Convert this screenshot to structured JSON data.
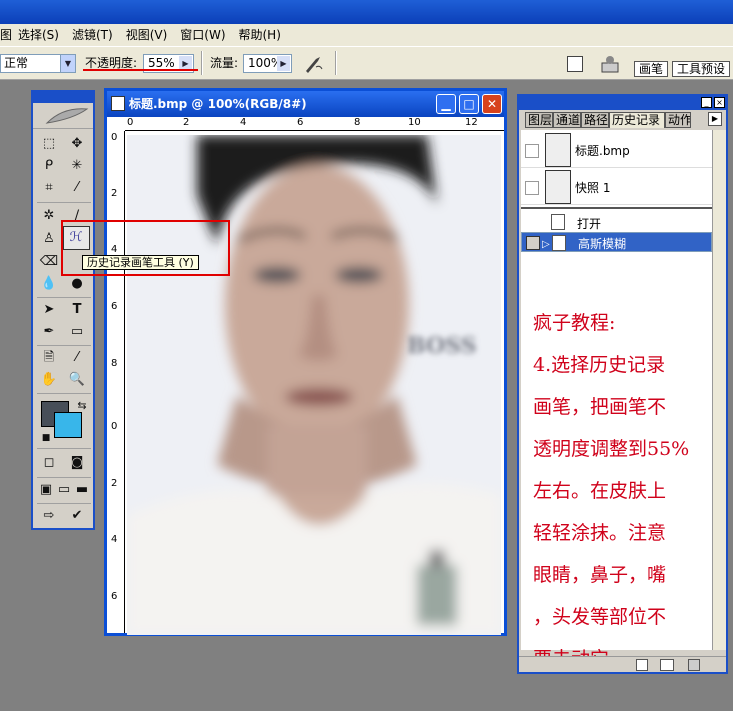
{
  "menu": {
    "items": [
      "图层",
      "选择(S)",
      "滤镜(T)",
      "视图(V)",
      "窗口(W)",
      "帮助(H)"
    ]
  },
  "options_bar": {
    "blend_mode": "正常",
    "opacity_label": "不透明度:",
    "opacity_value": "55%",
    "flow_label": "流量:",
    "flow_value": "100%",
    "palette_tabs": [
      "画笔",
      "工具预设"
    ]
  },
  "toolbox": {
    "foreground_color": "#474e58",
    "background_color": "#38b6ea",
    "tooltip": "历史记录画笔工具 (Y)"
  },
  "document": {
    "title": "标题.bmp @ 100%(RGB/8#)",
    "ruler_h": [
      "0",
      "2",
      "4",
      "6",
      "8",
      "10",
      "12"
    ],
    "ruler_v": [
      "0",
      "2",
      "4",
      "6",
      "8",
      "0",
      "2",
      "4",
      "6"
    ],
    "photo_text": "BOSS"
  },
  "history": {
    "tabs": [
      "图层",
      "通道",
      "路径",
      "历史记录",
      "动作"
    ],
    "snapshots": [
      "标题.bmp",
      "快照 1"
    ],
    "states": [
      "打开",
      "高斯模糊"
    ],
    "selected_state": "高斯模糊"
  },
  "tutorial": {
    "lines": [
      "疯子教程:",
      "4.选择历史记录",
      "画笔，把画笔不",
      "透明度调整到55%",
      "左右。在皮肤上",
      "轻轻涂抹。注意",
      "眼睛，鼻子，嘴",
      "，头发等部位不",
      "要去动它。"
    ]
  },
  "colors": {
    "annotation_red": "#d0021b",
    "title_blue": "#0b4fd6"
  }
}
